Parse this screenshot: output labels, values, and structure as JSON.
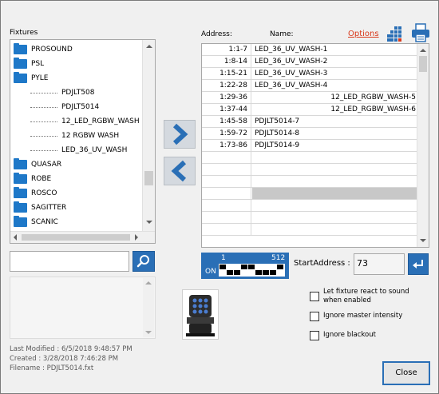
{
  "labels": {
    "fixtures": "Fixtures",
    "address": "Address:",
    "name": "Name:",
    "options": "Options",
    "start_address": "StartAddress :"
  },
  "tree": {
    "items": [
      {
        "type": "folder",
        "label": "PROSOUND"
      },
      {
        "type": "folder",
        "label": "PSL"
      },
      {
        "type": "folder",
        "label": "PYLE"
      },
      {
        "type": "leaf",
        "label": "PDJLT508"
      },
      {
        "type": "leaf",
        "label": "PDJLT5014"
      },
      {
        "type": "leaf",
        "label": "12_LED_RGBW_WASH"
      },
      {
        "type": "leaf",
        "label": "12 RGBW WASH"
      },
      {
        "type": "leaf",
        "label": "LED_36_UV_WASH"
      },
      {
        "type": "folder",
        "label": "QUASAR"
      },
      {
        "type": "folder",
        "label": "ROBE"
      },
      {
        "type": "folder",
        "label": "ROSCO"
      },
      {
        "type": "folder",
        "label": "SAGITTER"
      },
      {
        "type": "folder",
        "label": "SCANIC"
      }
    ]
  },
  "search": {
    "value": ""
  },
  "info": {
    "last_modified": "Last Modified : 6/5/2018 9:48:57 PM",
    "created": "Created : 3/28/2018 7:46:28 PM",
    "filename": "Filename : PDJLT5014.fxt"
  },
  "grid": {
    "rows": [
      {
        "address": "1:1-7",
        "name": "LED_36_UV_WASH-1",
        "align": "left"
      },
      {
        "address": "1:8-14",
        "name": "LED_36_UV_WASH-2",
        "align": "left"
      },
      {
        "address": "1:15-21",
        "name": "LED_36_UV_WASH-3",
        "align": "left"
      },
      {
        "address": "1:22-28",
        "name": "LED_36_UV_WASH-4",
        "align": "left"
      },
      {
        "address": "1:29-36",
        "name": "12_LED_RGBW_WASH-5",
        "align": "right"
      },
      {
        "address": "1:37-44",
        "name": "12_LED_RGBW_WASH-6",
        "align": "right"
      },
      {
        "address": "1:45-58",
        "name": "PDJLT5014-7",
        "align": "left"
      },
      {
        "address": "1:59-72",
        "name": "PDJLT5014-8",
        "align": "left"
      },
      {
        "address": "1:73-86",
        "name": "PDJLT5014-9",
        "align": "left"
      },
      {
        "address": "",
        "name": "",
        "align": "left"
      },
      {
        "address": "",
        "name": "",
        "align": "left"
      },
      {
        "address": "",
        "name": "",
        "align": "left"
      },
      {
        "address": "",
        "name": "",
        "align": "left",
        "selected": true
      },
      {
        "address": "",
        "name": "",
        "align": "left"
      },
      {
        "address": "",
        "name": "",
        "align": "left"
      },
      {
        "address": "",
        "name": "",
        "align": "left"
      }
    ]
  },
  "dmx": {
    "min": "1",
    "max": "512",
    "on": "ON"
  },
  "start_address": {
    "value": "73"
  },
  "checkboxes": [
    {
      "label_line1": "Let fixture react to sound",
      "label_line2": "when enabled",
      "checked": false
    },
    {
      "label_line1": "Ignore master intensity",
      "label_line2": "",
      "checked": false
    },
    {
      "label_line1": "Ignore blackout",
      "label_line2": "",
      "checked": false
    }
  ],
  "close_label": "Close",
  "icons": {
    "grid": "grid-icon",
    "print": "printer-icon",
    "search": "search-icon",
    "add": "chevron-right-icon",
    "remove": "chevron-left-icon",
    "enter": "enter-icon"
  },
  "colors": {
    "accent": "#2a6fb6",
    "folder": "#1e78c8",
    "options_link": "#d93a1c",
    "selected_row": "#c8c8c8"
  }
}
